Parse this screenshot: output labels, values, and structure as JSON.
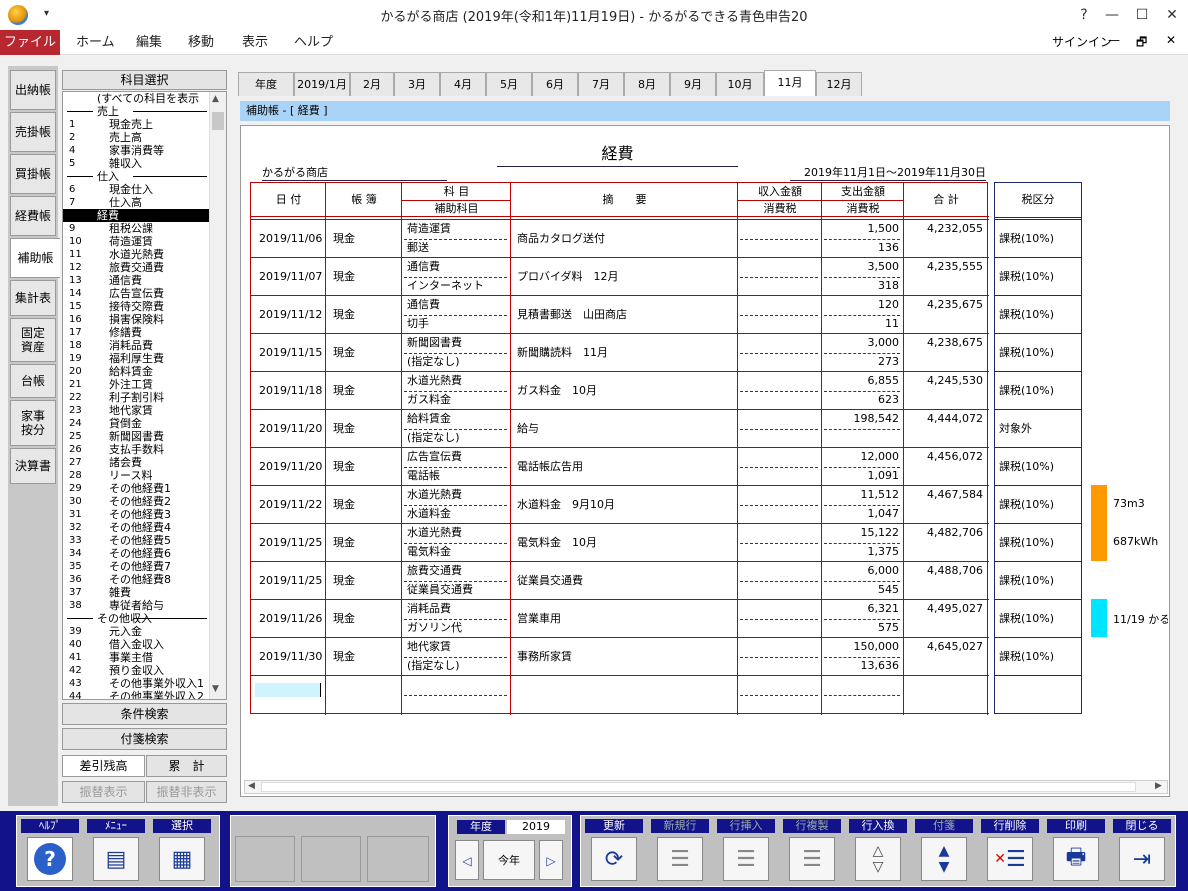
{
  "window": {
    "title": "かるがる商店 (2019年(令和1年)11月19日) - かるがるできる青色申告20",
    "help": "?",
    "minimize": "—",
    "maximize": "☐",
    "close": "✕"
  },
  "menu": [
    "ファイル",
    "ホーム",
    "編集",
    "移動",
    "表示",
    "ヘルプ"
  ],
  "signin": "サインイン",
  "small_controls": {
    "minimize": "—",
    "restore": "🗗",
    "close": "✕"
  },
  "left_tabs": [
    "出納帳",
    "売掛帳",
    "買掛帳",
    "経費帳",
    "補助帳",
    "集計表",
    "固定資産",
    "台帳",
    "家事按分",
    "決算書"
  ],
  "account_panel": {
    "title": "科目選択",
    "items": [
      {
        "no": "",
        "name": "(すべての科目を表示",
        "group": false
      },
      {
        "no": "",
        "name": "売上",
        "group": true
      },
      {
        "no": "1",
        "name": "現金売上"
      },
      {
        "no": "2",
        "name": "売上高"
      },
      {
        "no": "4",
        "name": "家事消費等"
      },
      {
        "no": "5",
        "name": "雑収入"
      },
      {
        "no": "",
        "name": "仕入",
        "group": true
      },
      {
        "no": "6",
        "name": "現金仕入"
      },
      {
        "no": "7",
        "name": "仕入高"
      },
      {
        "no": "",
        "name": "経費",
        "group": true,
        "selected": true
      },
      {
        "no": "9",
        "name": "租税公課"
      },
      {
        "no": "10",
        "name": "荷造運賃"
      },
      {
        "no": "11",
        "name": "水道光熱費"
      },
      {
        "no": "12",
        "name": "旅費交通費"
      },
      {
        "no": "13",
        "name": "通信費"
      },
      {
        "no": "14",
        "name": "広告宣伝費"
      },
      {
        "no": "15",
        "name": "接待交際費"
      },
      {
        "no": "16",
        "name": "損害保険料"
      },
      {
        "no": "17",
        "name": "修繕費"
      },
      {
        "no": "18",
        "name": "消耗品費"
      },
      {
        "no": "19",
        "name": "福利厚生費"
      },
      {
        "no": "20",
        "name": "給料賃金"
      },
      {
        "no": "21",
        "name": "外注工賃"
      },
      {
        "no": "22",
        "name": "利子割引料"
      },
      {
        "no": "23",
        "name": "地代家賃"
      },
      {
        "no": "24",
        "name": "貸倒金"
      },
      {
        "no": "25",
        "name": "新聞図書費"
      },
      {
        "no": "26",
        "name": "支払手数料"
      },
      {
        "no": "27",
        "name": "諸会費"
      },
      {
        "no": "28",
        "name": "リース料"
      },
      {
        "no": "29",
        "name": "その他経費1"
      },
      {
        "no": "30",
        "name": "その他経費2"
      },
      {
        "no": "31",
        "name": "その他経費3"
      },
      {
        "no": "32",
        "name": "その他経費4"
      },
      {
        "no": "33",
        "name": "その他経費5"
      },
      {
        "no": "34",
        "name": "その他経費6"
      },
      {
        "no": "35",
        "name": "その他経費7"
      },
      {
        "no": "36",
        "name": "その他経費8"
      },
      {
        "no": "37",
        "name": "雑費"
      },
      {
        "no": "38",
        "name": "専従者給与"
      },
      {
        "no": "",
        "name": "その他収入",
        "group": true
      },
      {
        "no": "39",
        "name": "元入金"
      },
      {
        "no": "40",
        "name": "借入金収入"
      },
      {
        "no": "41",
        "name": "事業主借"
      },
      {
        "no": "42",
        "name": "預り金収入"
      },
      {
        "no": "43",
        "name": "その他事業外収入1"
      },
      {
        "no": "44",
        "name": "その他事業外収入2"
      }
    ]
  },
  "buttons": {
    "condition_search": "条件検索",
    "tag_search": "付箋検索",
    "balance": "差引残高",
    "cumulative": "累　計",
    "transfer_show": "振替表示",
    "transfer_hide": "振替非表示"
  },
  "month_tabs": [
    "年度",
    "2019/1月",
    "2月",
    "3月",
    "4月",
    "5月",
    "6月",
    "7月",
    "8月",
    "9月",
    "10月",
    "11月",
    "12月"
  ],
  "subheader": "補助帳 - [ 経費 ]",
  "ledger": {
    "title": "経費",
    "company": "かるがる商店",
    "period": "2019年11月1日～2019年11月30日",
    "headers": {
      "date": "日 付",
      "book": "帳 簿",
      "account": "科 目",
      "sub_account": "補助科目",
      "desc": "摘　　要",
      "income": "収入金額",
      "income_tax": "消費税",
      "expense": "支出金額",
      "expense_tax": "消費税",
      "total": "合 計",
      "tax_class": "税区分"
    },
    "rows": [
      {
        "date": "2019/11/06",
        "book": "現金",
        "account": "荷造運賃",
        "sub": "郵送",
        "desc": "商品カタログ送付",
        "expense": "1,500",
        "tax": "136",
        "total": "4,232,055",
        "tax_class": "課税(10%)"
      },
      {
        "date": "2019/11/07",
        "book": "現金",
        "account": "通信費",
        "sub": "インターネット",
        "desc": "プロバイダ料　12月",
        "expense": "3,500",
        "tax": "318",
        "total": "4,235,555",
        "tax_class": "課税(10%)"
      },
      {
        "date": "2019/11/12",
        "book": "現金",
        "account": "通信費",
        "sub": "切手",
        "desc": "見積書郵送　山田商店",
        "expense": "120",
        "tax": "11",
        "total": "4,235,675",
        "tax_class": "課税(10%)"
      },
      {
        "date": "2019/11/15",
        "book": "現金",
        "account": "新聞図書費",
        "sub": "(指定なし)",
        "desc": "新聞購読料　11月",
        "expense": "3,000",
        "tax": "273",
        "total": "4,238,675",
        "tax_class": "課税(10%)"
      },
      {
        "date": "2019/11/18",
        "book": "現金",
        "account": "水道光熱費",
        "sub": "ガス料金",
        "desc": "ガス料金　10月",
        "expense": "6,855",
        "tax": "623",
        "total": "4,245,530",
        "tax_class": "課税(10%)"
      },
      {
        "date": "2019/11/20",
        "book": "現金",
        "account": "給料賃金",
        "sub": "(指定なし)",
        "desc": "給与",
        "expense": "198,542",
        "tax": "",
        "total": "4,444,072",
        "tax_class": "対象外"
      },
      {
        "date": "2019/11/20",
        "book": "現金",
        "account": "広告宣伝費",
        "sub": "電話帳",
        "desc": "電話帳広告用",
        "expense": "12,000",
        "tax": "1,091",
        "total": "4,456,072",
        "tax_class": "課税(10%)"
      },
      {
        "date": "2019/11/22",
        "book": "現金",
        "account": "水道光熱費",
        "sub": "水道料金",
        "desc": "水道料金　9月10月",
        "expense": "11,512",
        "tax": "1,047",
        "total": "4,467,584",
        "tax_class": "課税(10%)"
      },
      {
        "date": "2019/11/25",
        "book": "現金",
        "account": "水道光熱費",
        "sub": "電気料金",
        "desc": "電気料金　10月",
        "expense": "15,122",
        "tax": "1,375",
        "total": "4,482,706",
        "tax_class": "課税(10%)"
      },
      {
        "date": "2019/11/25",
        "book": "現金",
        "account": "旅費交通費",
        "sub": "従業員交通費",
        "desc": "従業員交通費",
        "expense": "6,000",
        "tax": "545",
        "total": "4,488,706",
        "tax_class": "課税(10%)"
      },
      {
        "date": "2019/11/26",
        "book": "現金",
        "account": "消耗品費",
        "sub": "ガソリン代",
        "desc": "営業車用",
        "expense": "6,321",
        "tax": "575",
        "total": "4,495,027",
        "tax_class": "課税(10%)"
      },
      {
        "date": "2019/11/30",
        "book": "現金",
        "account": "地代家賃",
        "sub": "(指定なし)",
        "desc": "事務所家賃",
        "expense": "150,000",
        "tax": "13,636",
        "total": "4,645,027",
        "tax_class": "課税(10%)"
      }
    ],
    "tags": [
      {
        "row": 7,
        "color": "#ff9900",
        "text": "73m3"
      },
      {
        "row": 8,
        "color": "#ff9900",
        "text": "687kWh"
      },
      {
        "row": 10,
        "color": "#00e5ff",
        "text": "11/19  かる"
      }
    ]
  },
  "toolbar": {
    "help": "ﾍﾙﾌﾟ",
    "menu": "ﾒﾆｭｰ",
    "select": "選択",
    "year_label": "年度",
    "year_value": "2019",
    "this_year": "今年",
    "prev": "◁",
    "next": "▷",
    "update": "更新",
    "new_row": "新規行",
    "insert_row": "行挿入",
    "copy_row": "行複製",
    "swap_row": "行入換",
    "tag": "付箋",
    "delete_row": "行削除",
    "print": "印刷",
    "close": "閉じる"
  }
}
